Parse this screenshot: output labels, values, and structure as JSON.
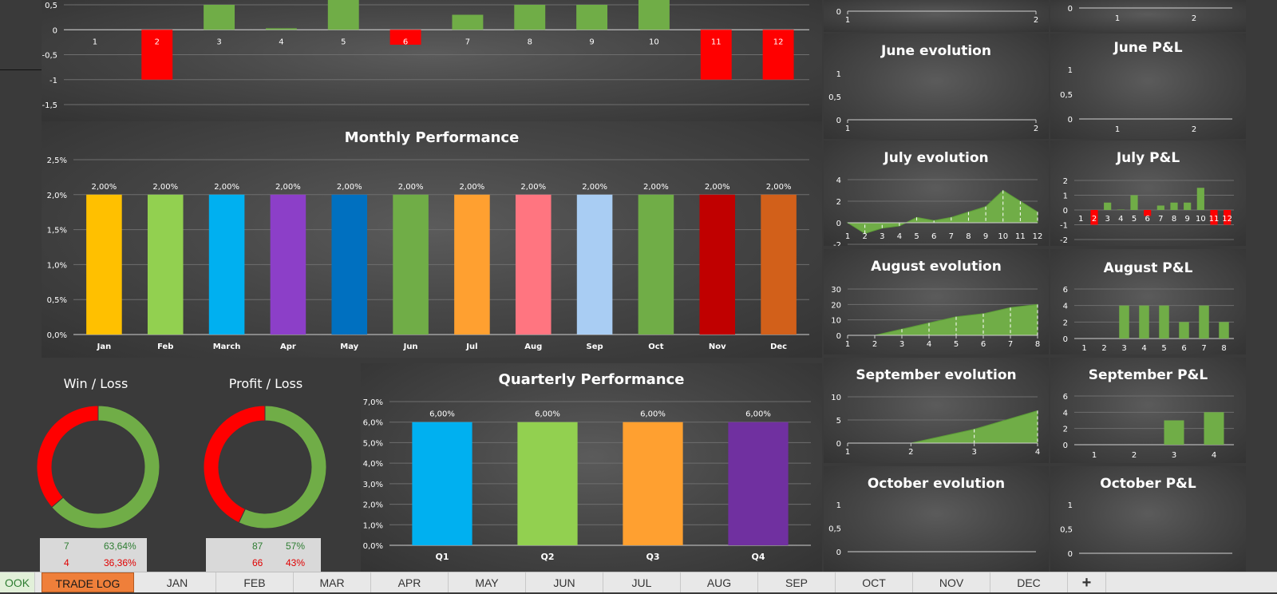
{
  "colors": {
    "positive": "#70ad47",
    "negative": "#ff0000",
    "grid": "#6e6e6e",
    "axis_text": "#ffffff"
  },
  "charts": {
    "top_pl": {
      "type": "bar",
      "categories": [
        "1",
        "2",
        "3",
        "4",
        "5",
        "6",
        "7",
        "8",
        "9",
        "10",
        "11",
        "12"
      ],
      "values": [
        0,
        -1,
        0.5,
        0.03,
        0.6,
        -0.3,
        0.3,
        0.5,
        0.5,
        0.6,
        -1,
        -1
      ],
      "y_ticks": [
        "0,5",
        "0",
        "-0,5",
        "-1",
        "-1,5"
      ]
    },
    "monthly": {
      "type": "bar",
      "title": "Monthly Performance",
      "categories": [
        "Jan",
        "Feb",
        "March",
        "Apr",
        "May",
        "Jun",
        "Jul",
        "Aug",
        "Sep",
        "Oct",
        "Nov",
        "Dec"
      ],
      "values": [
        2.0,
        2.0,
        2.0,
        2.0,
        2.0,
        2.0,
        2.0,
        2.0,
        2.0,
        2.0,
        2.0,
        2.0
      ],
      "labels": [
        "2,00%",
        "2,00%",
        "2,00%",
        "2,00%",
        "2,00%",
        "2,00%",
        "2,00%",
        "2,00%",
        "2,00%",
        "2,00%",
        "2,00%",
        "2,00%"
      ],
      "colors": [
        "#ffc000",
        "#92d050",
        "#00b0f0",
        "#8c3fc8",
        "#0070c0",
        "#70ad47",
        "#ffa030",
        "#ff7580",
        "#a9cdf3",
        "#70ad47",
        "#c00000",
        "#d2601a"
      ],
      "y_ticks": [
        "0,0%",
        "0,5%",
        "1,0%",
        "1,5%",
        "2,0%",
        "2,5%"
      ],
      "ylim": [
        0,
        2.5
      ]
    },
    "quarterly": {
      "type": "bar",
      "title": "Quarterly Performance",
      "categories": [
        "Q1",
        "Q2",
        "Q3",
        "Q4"
      ],
      "values": [
        6.0,
        6.0,
        6.0,
        6.0
      ],
      "labels": [
        "6,00%",
        "6,00%",
        "6,00%",
        "6,00%"
      ],
      "colors": [
        "#00b0f0",
        "#92d050",
        "#ffa030",
        "#7030a0"
      ],
      "y_ticks": [
        "0,0%",
        "1,0%",
        "2,0%",
        "3,0%",
        "4,0%",
        "5,0%",
        "6,0%",
        "7,0%"
      ],
      "ylim": [
        0,
        7
      ]
    },
    "win_loss": {
      "type": "pie",
      "title": "Win / Loss",
      "values": [
        63.64,
        36.36
      ],
      "colors": [
        "#70ad47",
        "#ff0000"
      ],
      "table": [
        {
          "count": "7",
          "pct": "63,64%"
        },
        {
          "count": "4",
          "pct": "36,36%"
        }
      ]
    },
    "profit_loss": {
      "type": "pie",
      "title": "Profit / Loss",
      "values": [
        57,
        43
      ],
      "colors": [
        "#70ad47",
        "#ff0000"
      ],
      "table": [
        {
          "count": "87",
          "pct": "57%"
        },
        {
          "count": "66",
          "pct": "43%"
        }
      ]
    },
    "may_evolution": {
      "type": "area",
      "x_ticks": [
        "1",
        "2"
      ],
      "y_ticks": [
        "0"
      ],
      "ylim": [
        0,
        1
      ],
      "values": []
    },
    "may_pl": {
      "type": "bar",
      "x_ticks": [
        "1",
        "2"
      ],
      "y_ticks": [
        "0"
      ],
      "ylim": [
        0,
        1
      ],
      "values": []
    },
    "june_evolution": {
      "type": "area",
      "title": "June evolution",
      "x_ticks": [
        "1",
        "2"
      ],
      "y_ticks": [
        "0",
        "0,5",
        "1"
      ],
      "ylim": [
        0,
        1
      ],
      "values": []
    },
    "june_pl": {
      "type": "bar",
      "title": "June P&L",
      "x_ticks": [
        "1",
        "2"
      ],
      "y_ticks": [
        "0",
        "0,5",
        "1"
      ],
      "ylim": [
        0,
        1
      ],
      "values": []
    },
    "july_evolution": {
      "type": "area",
      "title": "July evolution",
      "x_ticks": [
        "1",
        "2",
        "3",
        "4",
        "5",
        "6",
        "7",
        "8",
        "9",
        "10",
        "11",
        "12"
      ],
      "y_ticks": [
        "-2",
        "0",
        "2",
        "4"
      ],
      "ylim": [
        -2,
        4
      ],
      "values": [
        0,
        -1,
        -0.5,
        -0.3,
        0.5,
        0.2,
        0.5,
        1.0,
        1.5,
        3.0,
        2.0,
        1.0
      ]
    },
    "july_pl": {
      "type": "bar",
      "title": "July P&L",
      "categories": [
        "1",
        "2",
        "3",
        "4",
        "5",
        "6",
        "7",
        "8",
        "9",
        "10",
        "11",
        "12"
      ],
      "values": [
        0,
        -1,
        0.5,
        0.03,
        1.0,
        -0.4,
        0.3,
        0.5,
        0.5,
        1.5,
        -1,
        -1
      ],
      "y_ticks": [
        "-2",
        "-1",
        "0",
        "1",
        "2"
      ],
      "ylim": [
        -2,
        2
      ]
    },
    "august_evolution": {
      "type": "area",
      "title": "August evolution",
      "x_ticks": [
        "1",
        "2",
        "3",
        "4",
        "5",
        "6",
        "7",
        "8"
      ],
      "y_ticks": [
        "0",
        "10",
        "20",
        "30"
      ],
      "ylim": [
        0,
        30
      ],
      "values": [
        0,
        0,
        4,
        8,
        12,
        14,
        18,
        20
      ]
    },
    "august_pl": {
      "type": "bar",
      "title": "August P&L",
      "categories": [
        "1",
        "2",
        "3",
        "4",
        "5",
        "6",
        "7",
        "8"
      ],
      "values": [
        0,
        0,
        4,
        4,
        4,
        2,
        4,
        2
      ],
      "y_ticks": [
        "0",
        "2",
        "4",
        "6"
      ],
      "ylim": [
        0,
        6
      ]
    },
    "september_evolution": {
      "type": "area",
      "title": "September evolution",
      "x_ticks": [
        "1",
        "2",
        "3",
        "4"
      ],
      "y_ticks": [
        "0",
        "5",
        "10"
      ],
      "ylim": [
        0,
        10
      ],
      "values": [
        0,
        0,
        3,
        7
      ]
    },
    "september_pl": {
      "type": "bar",
      "title": "September P&L",
      "categories": [
        "1",
        "2",
        "3",
        "4"
      ],
      "values": [
        0,
        0,
        3,
        4
      ],
      "y_ticks": [
        "0",
        "2",
        "4",
        "6"
      ],
      "ylim": [
        0,
        6
      ]
    },
    "october_evolution": {
      "type": "area",
      "title": "October evolution",
      "y_ticks": [
        "0",
        "0,5",
        "1"
      ],
      "ylim": [
        0,
        1
      ],
      "values": []
    },
    "october_pl": {
      "type": "bar",
      "title": "October P&L",
      "y_ticks": [
        "0",
        "0,5",
        "1"
      ],
      "ylim": [
        0,
        1
      ],
      "values": []
    }
  },
  "tabs": [
    "OOK",
    "TRADE LOG",
    "JAN",
    "FEB",
    "MAR",
    "APR",
    "MAY",
    "JUN",
    "JUL",
    "AUG",
    "SEP",
    "OCT",
    "NOV",
    "DEC",
    "+"
  ]
}
